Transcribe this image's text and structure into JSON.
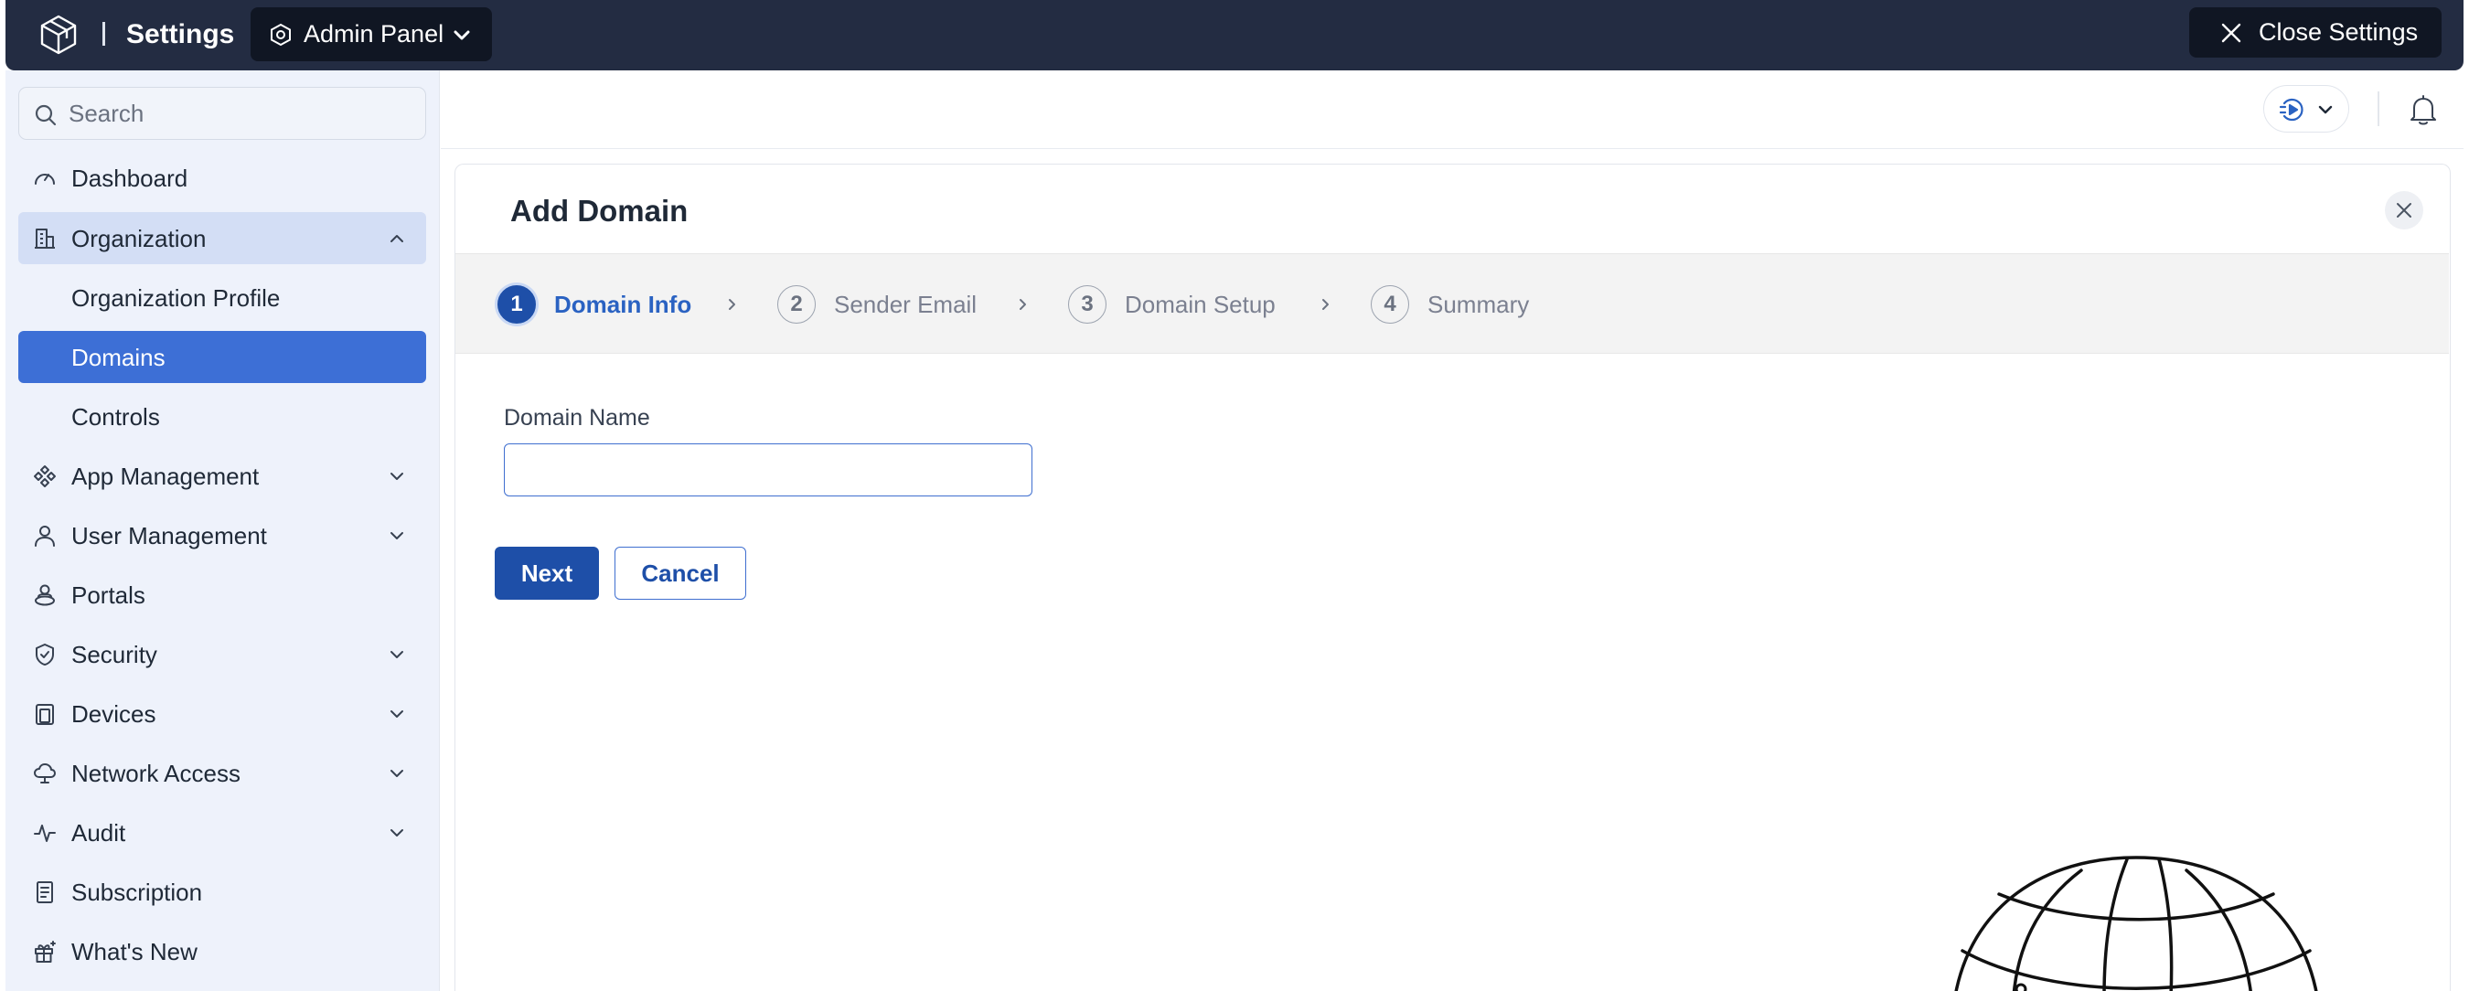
{
  "topbar": {
    "title": "Settings",
    "panel_label": "Admin Panel",
    "close_label": "Close Settings"
  },
  "sidebar": {
    "search_placeholder": "Search",
    "items": [
      {
        "label": "Dashboard",
        "icon": "dashboard-icon"
      },
      {
        "label": "Organization",
        "icon": "building-icon",
        "expanded": true
      },
      {
        "label": "Organization Profile",
        "sub": true
      },
      {
        "label": "Domains",
        "sub": true,
        "active": true
      },
      {
        "label": "Controls",
        "sub": true
      },
      {
        "label": "App Management",
        "icon": "apps-icon"
      },
      {
        "label": "User Management",
        "icon": "user-icon"
      },
      {
        "label": "Portals",
        "icon": "portal-icon"
      },
      {
        "label": "Security",
        "icon": "shield-icon"
      },
      {
        "label": "Devices",
        "icon": "devices-icon"
      },
      {
        "label": "Network Access",
        "icon": "cloud-icon"
      },
      {
        "label": "Audit",
        "icon": "pulse-icon"
      },
      {
        "label": "Subscription",
        "icon": "receipt-icon"
      },
      {
        "label": "What's New",
        "icon": "gift-icon"
      }
    ]
  },
  "dialog": {
    "title": "Add Domain",
    "steps": [
      {
        "num": "1",
        "label": "Domain Info",
        "state": "current"
      },
      {
        "num": "2",
        "label": "Sender Email",
        "state": "pending"
      },
      {
        "num": "3",
        "label": "Domain Setup",
        "state": "pending"
      },
      {
        "num": "4",
        "label": "Summary",
        "state": "pending"
      }
    ],
    "field_label": "Domain Name",
    "field_value": "",
    "next_label": "Next",
    "cancel_label": "Cancel"
  },
  "colors": {
    "topbar": "#232c42",
    "primary": "#1e4fa8",
    "active_nav": "#3d6fd6",
    "sidebar_bg": "#eef2fb"
  }
}
